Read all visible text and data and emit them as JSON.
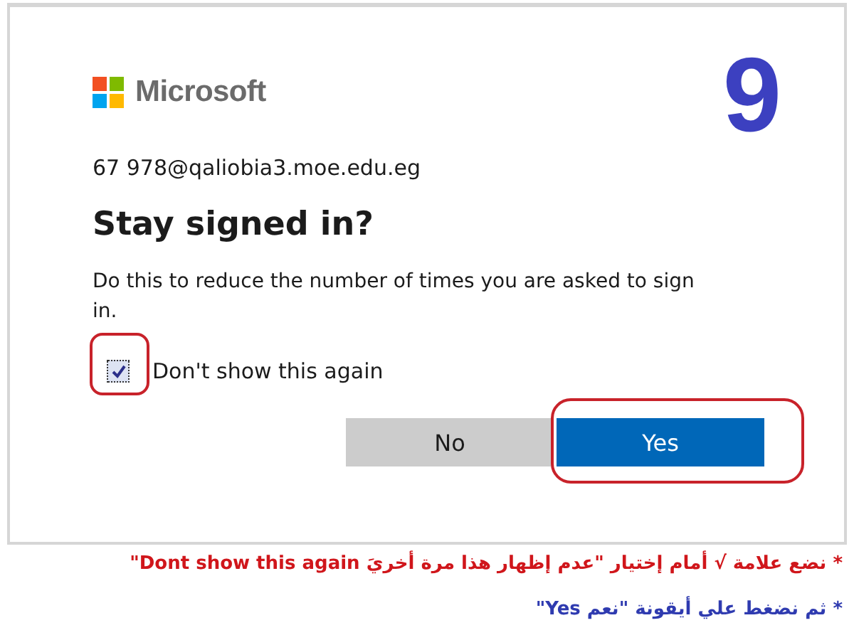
{
  "step_number": "9",
  "dialog": {
    "brand": "Microsoft",
    "account": "67 978@qaliobia3.moe.edu.eg",
    "title": "Stay signed in?",
    "message": "Do this to reduce the number of times you are asked to sign in.",
    "checkbox": {
      "label": "Don't show this again",
      "checked": true,
      "highlighted": true
    },
    "buttons": [
      {
        "label": "No",
        "kind": "secondary",
        "highlighted": false
      },
      {
        "label": "Yes",
        "kind": "primary",
        "highlighted": true
      }
    ]
  },
  "instructions": [
    {
      "text": "* نضع علامة √ أمام إختيار  \"عدم إظهار هذا مرة أخريَ  Dont show this again\"",
      "color": "#d0161b"
    },
    {
      "text": "* ثم نضغط علي أيقونة   \"نعم  Yes\"",
      "color": "#2f3bb0"
    }
  ]
}
